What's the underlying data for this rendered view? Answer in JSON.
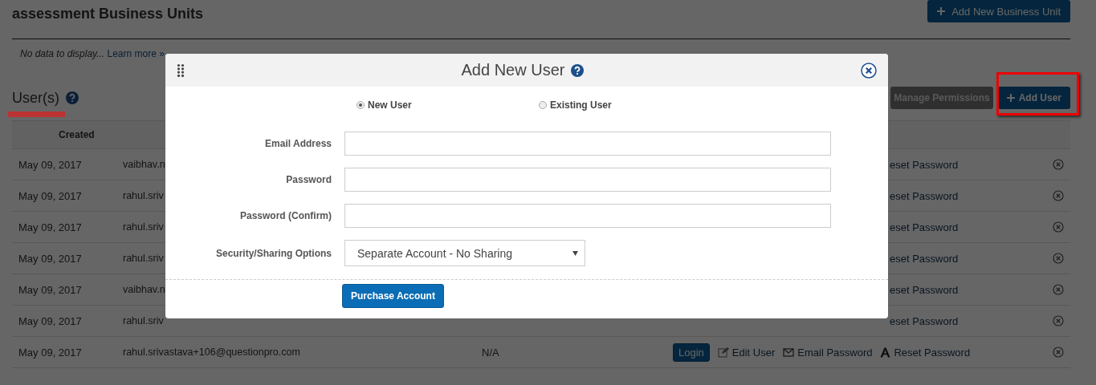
{
  "page_title": "assessment Business Units",
  "add_business_unit_button": "Add New Business Unit",
  "empty_message": {
    "text": "No data to display...",
    "link": "Learn more »"
  },
  "users_section": {
    "title": "User(s)",
    "manage_permissions_button": "Manage Permissions",
    "add_user_button": "Add User",
    "table": {
      "columns": [
        "Created"
      ],
      "rows": [
        {
          "kind": "partial",
          "created": "May 09, 2017",
          "email": "vaibhav.n",
          "action": "eset Password"
        },
        {
          "kind": "partial",
          "created": "May 09, 2017",
          "email": "rahul.sriv",
          "action": "eset Password"
        },
        {
          "kind": "partial",
          "created": "May 09, 2017",
          "email": "rahul.sriv",
          "action": "eset Password"
        },
        {
          "kind": "partial",
          "created": "May 09, 2017",
          "email": "rahul.sriv",
          "action": "eset Password"
        },
        {
          "kind": "partial",
          "created": "May 09, 2017",
          "email": "vaibhav.n",
          "action": "eset Password"
        },
        {
          "kind": "partial",
          "created": "May 09, 2017",
          "email": "rahul.sriv",
          "action": "eset Password"
        },
        {
          "kind": "full",
          "created": "May 09, 2017",
          "email": "rahul.srivastava+106@questionpro.com",
          "status": "N/A",
          "login_button": "Login",
          "actions": [
            "Edit User",
            "Email Password",
            "Reset Password"
          ]
        }
      ]
    }
  },
  "dialog": {
    "title": "Add New User",
    "user_type": [
      {
        "label": "New User",
        "selected": true
      },
      {
        "label": "Existing User",
        "selected": false
      }
    ],
    "fields": [
      {
        "kind": "text",
        "label": "Email Address"
      },
      {
        "kind": "text",
        "label": "Password"
      },
      {
        "kind": "text",
        "label": "Password (Confirm)"
      },
      {
        "kind": "select",
        "label": "Security/Sharing Options",
        "value": "Separate Account - No Sharing"
      }
    ],
    "submit_button": "Purchase Account"
  }
}
